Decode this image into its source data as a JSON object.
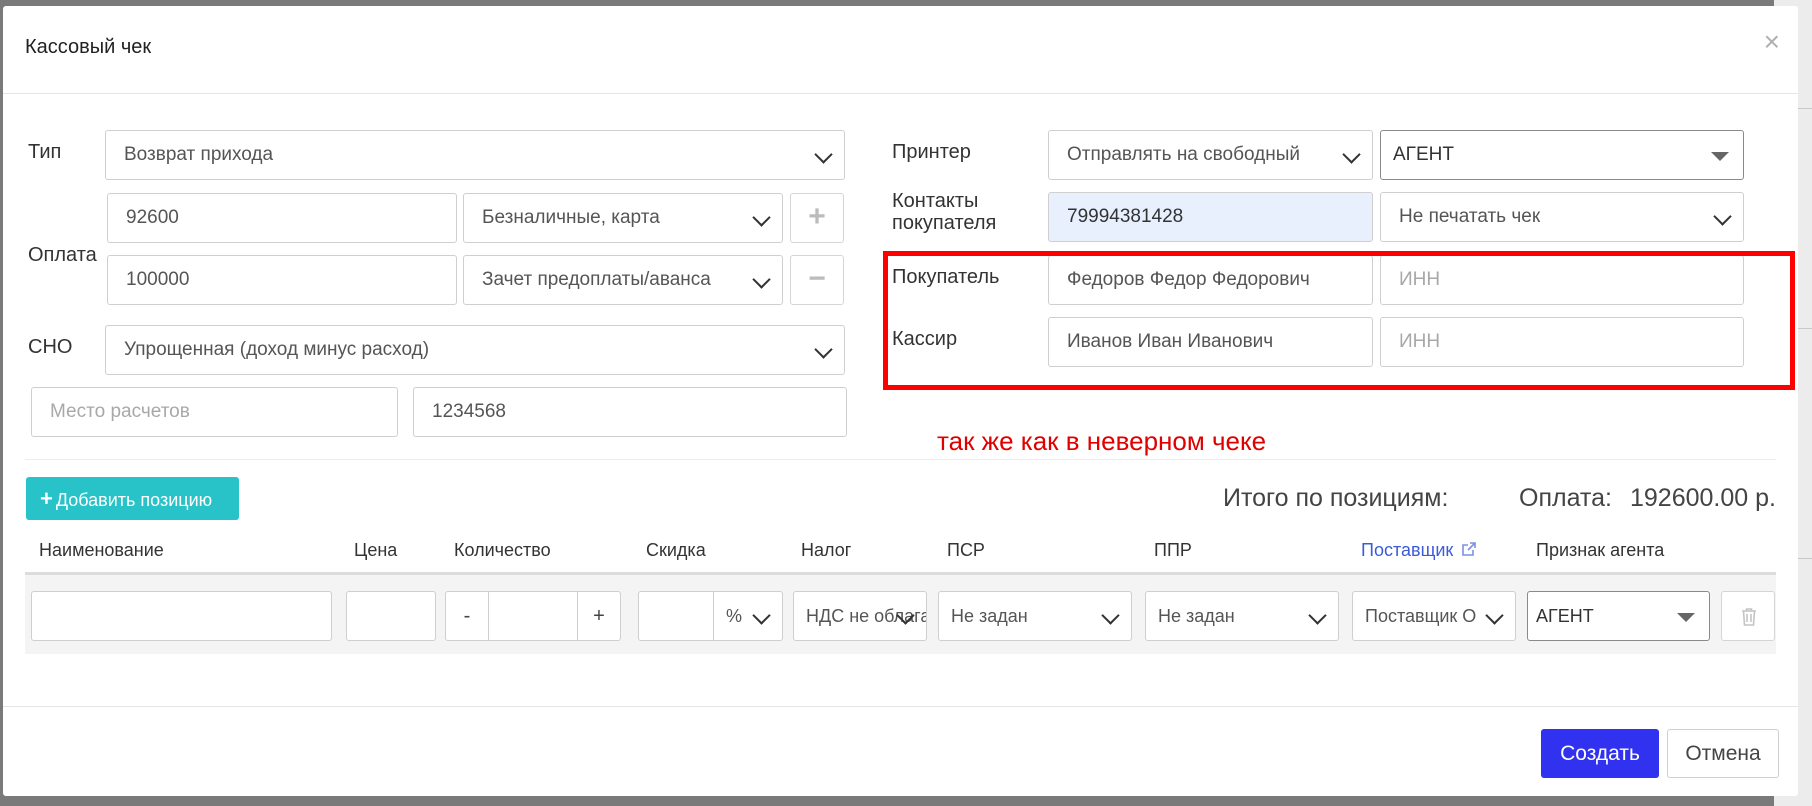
{
  "dialog": {
    "title": "Кассовый чек",
    "close_glyph": "×"
  },
  "form": {
    "type_label": "Тип",
    "type_value": "Возврат прихода",
    "payment_label": "Оплата",
    "payments": [
      {
        "amount": "92600",
        "method": "Безналичные, карта"
      },
      {
        "amount": "100000",
        "method": "Зачет предоплаты/аванса"
      }
    ],
    "add_payment_glyph": "+",
    "remove_payment_glyph": "−",
    "sno_label": "СНО",
    "sno_value": "Упрощенная (доход минус расход)",
    "place_placeholder": "Место расчетов",
    "code_value": "1234568",
    "printer_label": "Принтер",
    "printer_value": "Отправлять на свободный",
    "agent_value": "АГЕНТ",
    "contacts_label_line1": "Контакты",
    "contacts_label_line2": "покупателя",
    "contacts_value": "79994381428",
    "print_value": "Не печатать чек",
    "buyer_label": "Покупатель",
    "buyer_value": "Федоров Федор Федорович",
    "buyer_inn_placeholder": "ИНН",
    "cashier_label": "Кассир",
    "cashier_value": "Иванов Иван Иванович",
    "cashier_inn_placeholder": "ИНН"
  },
  "annotation": {
    "note": "так же как в неверном чеке",
    "color": "#ff0000"
  },
  "positions": {
    "add_label": "Добавить позицию",
    "total_label": "Итого по позициям:",
    "payment_label": "Оплата:",
    "payment_total": "192600.00 р.",
    "columns": [
      "Наименование",
      "Цена",
      "Количество",
      "Скидка",
      "Налог",
      "ПСР",
      "ППР",
      "Поставщик",
      "Признак агента"
    ],
    "row": {
      "minus": "-",
      "plus": "+",
      "discount_unit": "%",
      "tax": "НДС не облагается",
      "psr": "Не задан",
      "ppr": "Не задан",
      "supplier": "Поставщик О",
      "agent": "АГЕНТ"
    }
  },
  "footer": {
    "create": "Создать",
    "cancel": "Отмена"
  },
  "colors": {
    "accent": "#3131f0",
    "teal": "#27c3c8",
    "link": "#3b5bdb"
  }
}
